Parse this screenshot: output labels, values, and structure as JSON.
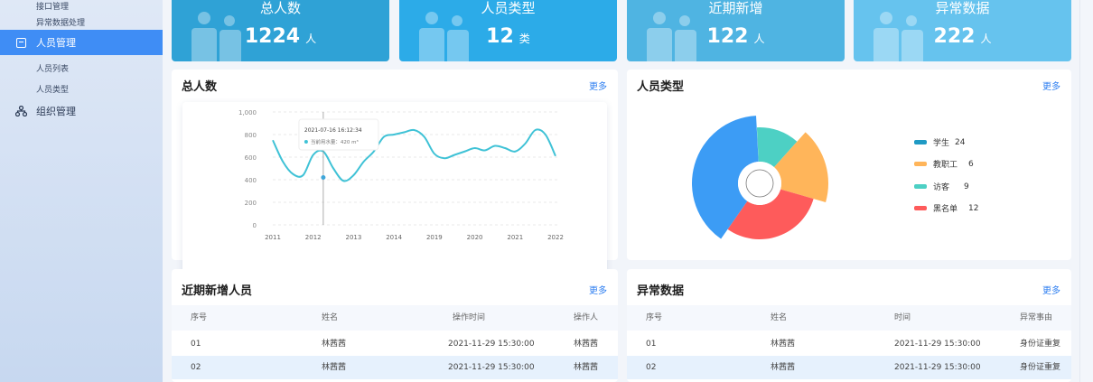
{
  "sidebar": {
    "items_top": [
      {
        "label": "接口管理"
      },
      {
        "label": "异常数据处理"
      }
    ],
    "active": {
      "label": "人员管理",
      "icon": "chart-box-icon"
    },
    "subitems": [
      {
        "label": "人员列表"
      },
      {
        "label": "人员类型"
      }
    ],
    "org": {
      "label": "组织管理",
      "icon": "org-tree-icon"
    }
  },
  "stats": [
    {
      "title": "总人数",
      "value": "1224",
      "unit": "人",
      "color": "#2fa2d6"
    },
    {
      "title": "人员类型",
      "value": "12",
      "unit": "类",
      "color": "#2cabe8"
    },
    {
      "title": "近期新增",
      "value": "122",
      "unit": "人",
      "color": "#4fb4e2"
    },
    {
      "title": "异常数据",
      "value": "222",
      "unit": "人",
      "color": "#66c3ee"
    }
  ],
  "total_card": {
    "title": "总人数",
    "more": "更多"
  },
  "type_card": {
    "title": "人员类型",
    "more": "更多"
  },
  "new_card": {
    "title": "近期新增人员",
    "more": "更多"
  },
  "abnormal_card": {
    "title": "异常数据",
    "more": "更多"
  },
  "tooltip": {
    "time": "2021-07-16 16:12:34",
    "text": "当前用水量：420 m³"
  },
  "chart_data": [
    {
      "type": "line",
      "x": [
        "2011",
        "2012",
        "2013",
        "2014",
        "2019",
        "2020",
        "2021",
        "2022"
      ],
      "yticks": [
        "0",
        "200",
        "400",
        "600",
        "800",
        "1,000"
      ],
      "ylim": [
        0,
        1000
      ],
      "grid": true,
      "points": [
        [
          0,
          750
        ],
        [
          0.25,
          560
        ],
        [
          0.5,
          450
        ],
        [
          0.75,
          440
        ],
        [
          1,
          620
        ],
        [
          1.25,
          650
        ],
        [
          1.5,
          500
        ],
        [
          1.75,
          390
        ],
        [
          2,
          440
        ],
        [
          2.25,
          560
        ],
        [
          2.5,
          650
        ],
        [
          2.75,
          780
        ],
        [
          3,
          800
        ],
        [
          3.25,
          820
        ],
        [
          3.5,
          840
        ],
        [
          3.75,
          780
        ],
        [
          4,
          630
        ],
        [
          4.25,
          590
        ],
        [
          4.5,
          620
        ],
        [
          4.75,
          650
        ],
        [
          5,
          680
        ],
        [
          5.25,
          660
        ],
        [
          5.5,
          700
        ],
        [
          5.75,
          680
        ],
        [
          6,
          650
        ],
        [
          6.25,
          720
        ],
        [
          6.5,
          840
        ],
        [
          6.75,
          800
        ],
        [
          7,
          610
        ]
      ],
      "values": [
        750,
        620,
        440,
        800,
        630,
        680,
        650,
        610
      ]
    },
    {
      "type": "pie",
      "legend_position": "right",
      "series": [
        {
          "name": "学生",
          "value": 24,
          "color": "#3c9cf5"
        },
        {
          "name": "教职工",
          "value": 6,
          "color": "#ffb55a"
        },
        {
          "name": "访客",
          "value": 9,
          "color": "#4dd0c4"
        },
        {
          "name": "黑名单",
          "value": 12,
          "color": "#fe5b5b"
        }
      ],
      "legend_colors": [
        "#1f9ac4",
        "#ffb55a",
        "#4dd0c4",
        "#fe5b5b"
      ]
    }
  ],
  "new_table": {
    "headers": [
      "序号",
      "姓名",
      "操作时间",
      "操作人"
    ],
    "rows": [
      [
        "01",
        "林茜茜",
        "2021-11-29 15:30:00",
        "林茜茜"
      ],
      [
        "02",
        "林茜茜",
        "2021-11-29 15:30:00",
        "林茜茜"
      ]
    ]
  },
  "abnormal_table": {
    "headers": [
      "序号",
      "姓名",
      "时间",
      "异常事由"
    ],
    "rows": [
      [
        "01",
        "林茜茜",
        "2021-11-29 15:30:00",
        "身份证重复"
      ],
      [
        "02",
        "林茜茜",
        "2021-11-29 15:30:00",
        "身份证重复"
      ]
    ]
  }
}
